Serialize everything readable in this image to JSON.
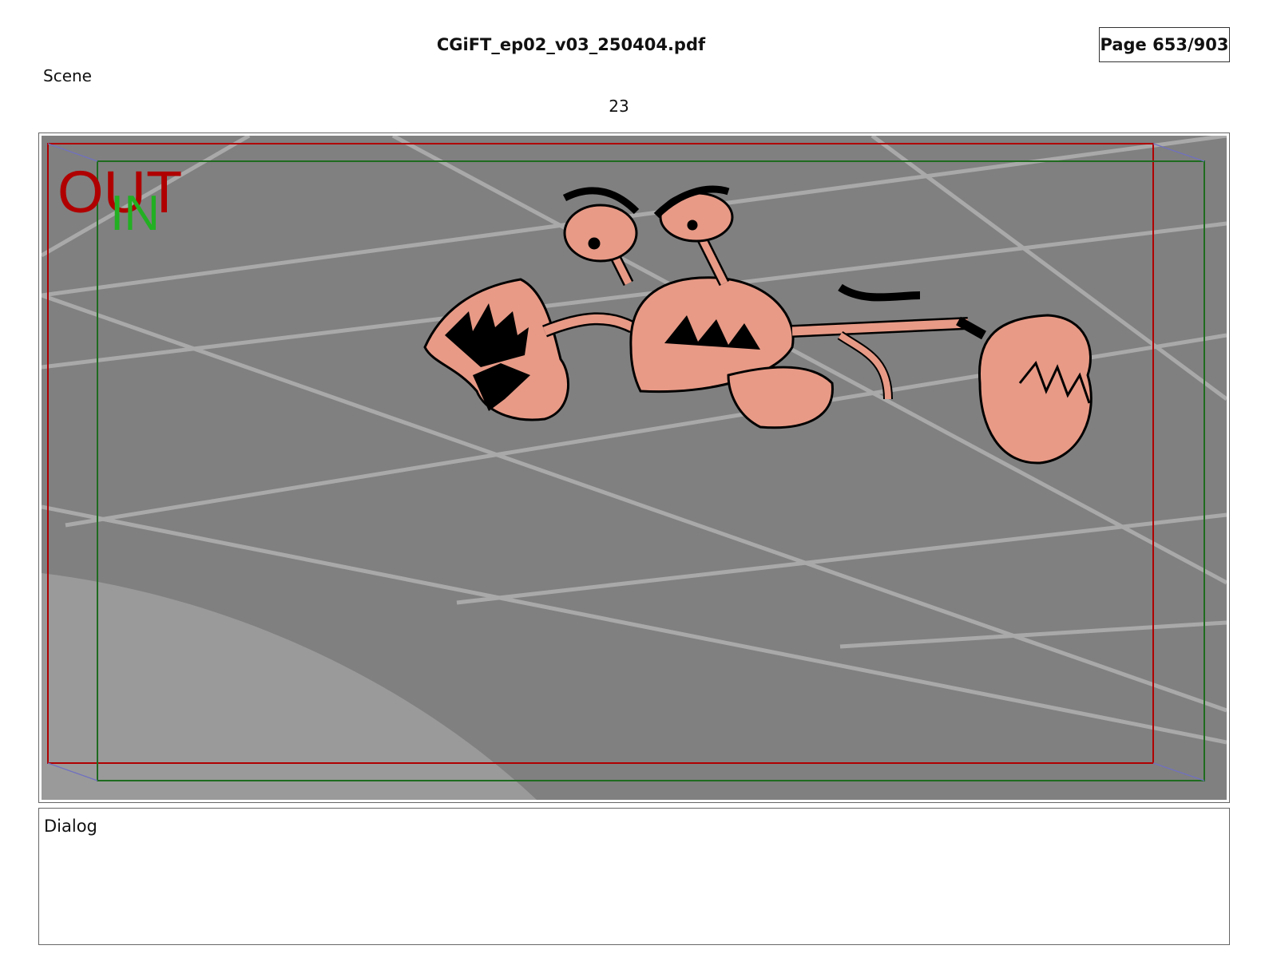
{
  "header": {
    "file_title": "CGiFT_ep02_v03_250404.pdf",
    "page_indicator": "Page 653/903"
  },
  "scene": {
    "label": "Scene",
    "number": "23"
  },
  "frame": {
    "out_label": "OUT",
    "in_label": "IN",
    "out_color": "#b00000",
    "in_color": "#22b022",
    "background_color": "#808080",
    "character_color": "#e89a86"
  },
  "dialog": {
    "label": "Dialog",
    "text": ""
  }
}
